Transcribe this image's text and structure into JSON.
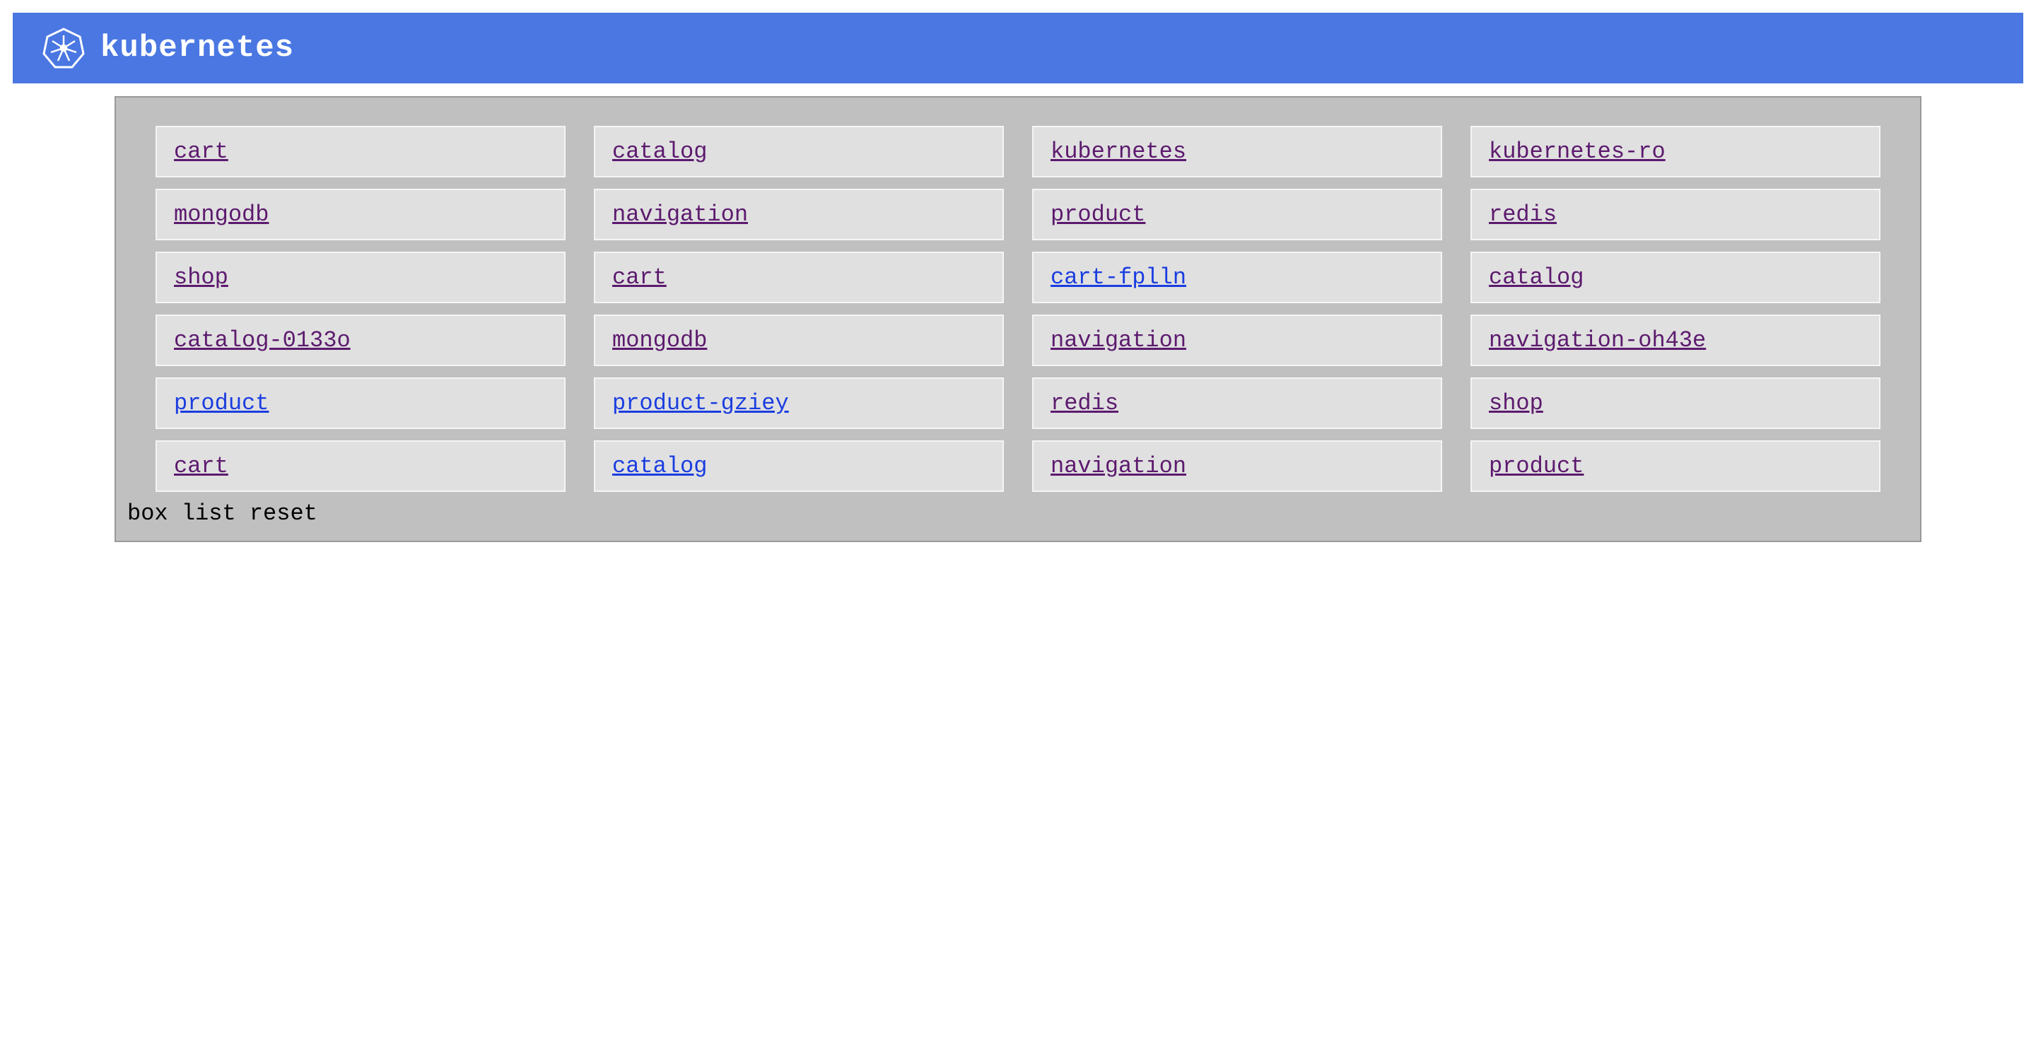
{
  "header": {
    "brand": "kubernetes"
  },
  "grid": {
    "items": [
      {
        "label": "cart",
        "color": "purple"
      },
      {
        "label": "catalog",
        "color": "purple"
      },
      {
        "label": "kubernetes",
        "color": "purple"
      },
      {
        "label": "kubernetes-ro",
        "color": "purple"
      },
      {
        "label": "mongodb",
        "color": "purple"
      },
      {
        "label": "navigation",
        "color": "purple"
      },
      {
        "label": "product",
        "color": "purple"
      },
      {
        "label": "redis",
        "color": "purple"
      },
      {
        "label": "shop",
        "color": "purple"
      },
      {
        "label": "cart",
        "color": "purple"
      },
      {
        "label": "cart-fplln",
        "color": "blue"
      },
      {
        "label": "catalog",
        "color": "purple"
      },
      {
        "label": "catalog-0133o",
        "color": "purple"
      },
      {
        "label": "mongodb",
        "color": "purple"
      },
      {
        "label": "navigation",
        "color": "purple"
      },
      {
        "label": "navigation-oh43e",
        "color": "purple"
      },
      {
        "label": "product",
        "color": "blue"
      },
      {
        "label": "product-gziey",
        "color": "blue"
      },
      {
        "label": "redis",
        "color": "purple"
      },
      {
        "label": "shop",
        "color": "purple"
      },
      {
        "label": "cart",
        "color": "purple"
      },
      {
        "label": "catalog",
        "color": "blue"
      },
      {
        "label": "navigation",
        "color": "purple"
      },
      {
        "label": "product",
        "color": "purple"
      }
    ]
  },
  "status": {
    "text": "box list reset"
  }
}
